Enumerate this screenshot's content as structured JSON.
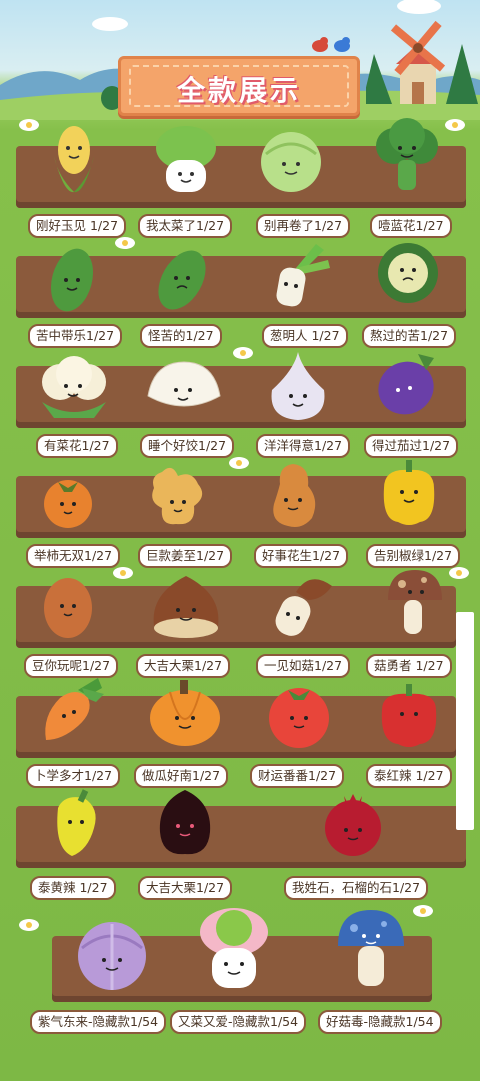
{
  "title": "全款展示",
  "rows": [
    [
      "刚好玉见 1/27",
      "我太菜了1/27",
      "别再卷了1/27",
      "噎蓝花1/27"
    ],
    [
      "苦中带乐1/27",
      "怪苦的1/27",
      "葱明人 1/27",
      "熬过的苦1/27"
    ],
    [
      "有菜花1/27",
      "睡个好饺1/27",
      "洋洋得意1/27",
      "得过茄过1/27"
    ],
    [
      "举柿无双1/27",
      "巨款姜至1/27",
      "好事花生1/27",
      "告别椒绿1/27"
    ],
    [
      "豆你玩呢1/27",
      "大吉大栗1/27",
      "一见如菇1/27",
      "菇勇者 1/27"
    ],
    [
      "卜学多才1/27",
      "做瓜好南1/27",
      "财运番番1/27",
      "泰红辣 1/27"
    ],
    [
      "泰黄辣 1/27",
      "大吉大栗1/27",
      "我姓石，石榴的石1/27"
    ],
    [
      "紫气东来-隐藏款1/54",
      "又菜又爱-隐藏款1/54",
      "好菇毒-隐藏款1/54"
    ]
  ],
  "icons": {
    "r0": [
      "corn-icon",
      "bok-choy-icon",
      "cabbage-icon",
      "broccoli-icon"
    ],
    "r1": [
      "bitter-melon-icon",
      "bitter-melon-icon",
      "scallion-icon",
      "cut-bitter-melon-icon"
    ],
    "r2": [
      "cauliflower-icon",
      "dumpling-icon",
      "garlic-icon",
      "eggplant-icon"
    ],
    "r3": [
      "persimmon-icon",
      "ginger-icon",
      "peanut-icon",
      "bell-pepper-icon"
    ],
    "r4": [
      "potato-icon",
      "chestnut-icon",
      "shiitake-icon",
      "mushroom-icon"
    ],
    "r5": [
      "carrot-icon",
      "pumpkin-icon",
      "tomato-icon",
      "red-pepper-icon"
    ],
    "r6": [
      "yellow-pepper-icon",
      "dark-chestnut-icon",
      "pomegranate-icon"
    ],
    "r7": [
      "purple-cabbage-icon",
      "pink-bok-choy-icon",
      "blue-mushroom-icon"
    ]
  },
  "colors": {
    "soil": "#8b5a3c",
    "grass": "#7db845",
    "banner": "#f4a46a"
  }
}
